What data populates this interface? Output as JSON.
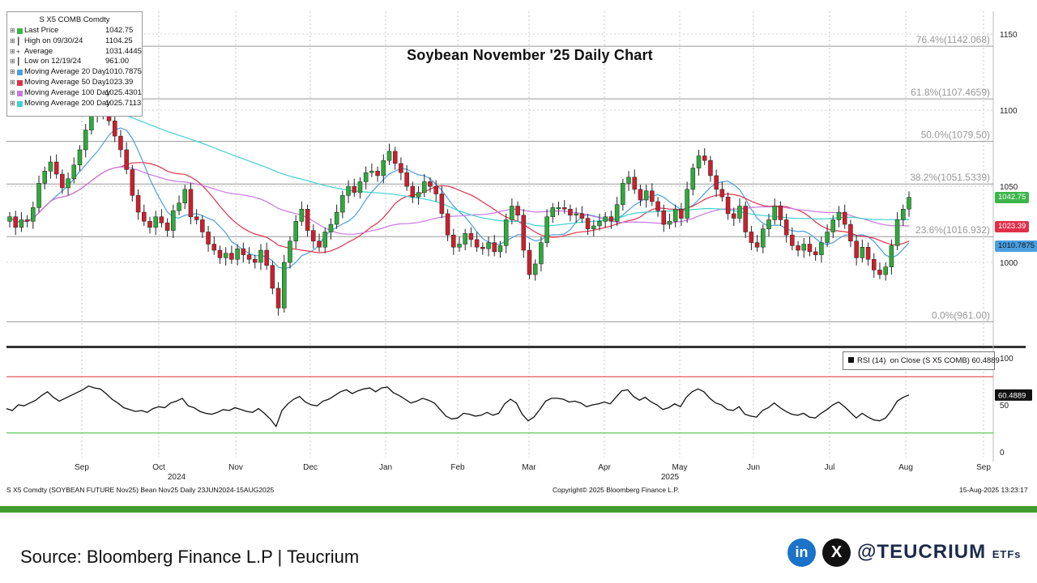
{
  "chart_data": {
    "type": "candlestick",
    "title": "Soybean November '25 Daily Chart",
    "ticker": "S X5 COMB Comdty",
    "x_axis": {
      "months": [
        "Sep",
        "Oct",
        "Nov",
        "Dec",
        "Jan",
        "Feb",
        "Mar",
        "Apr",
        "May",
        "Jun",
        "Jul",
        "Aug",
        "Sep"
      ],
      "years": [
        "2024",
        "2025"
      ]
    },
    "y_axis": {
      "ticks": [
        1150,
        1100,
        1050,
        1000
      ],
      "range": [
        950,
        1165
      ]
    },
    "legend": [
      {
        "label": "Last Price",
        "value": "1042.75",
        "color": "#3bb54a"
      },
      {
        "label": "High on 09/30/24",
        "value": "1104.25",
        "glyph": "T"
      },
      {
        "label": "Average",
        "value": "1031.4445",
        "glyph": "-+-"
      },
      {
        "label": "Low on 12/19/24",
        "value": "961.00",
        "glyph": "L"
      },
      {
        "label": "Moving Average 20 Day",
        "value": "1010.7875",
        "color": "#4a9fe0"
      },
      {
        "label": "Moving Average 50 Day",
        "value": "1023.39",
        "color": "#e0304a"
      },
      {
        "label": "Moving Average 100 Day",
        "value": "1025.4301",
        "color": "#c878e0"
      },
      {
        "label": "Moving Average 200 Day",
        "value": "1025.7113",
        "color": "#40d0d0"
      }
    ],
    "fibonacci": [
      {
        "label": "76.4%(1142.068)",
        "value": 1142.068
      },
      {
        "label": "61.8%(1107.4659)",
        "value": 1107.4659
      },
      {
        "label": "50.0%(1079.50)",
        "value": 1079.5
      },
      {
        "label": "38.2%(1051.5339)",
        "value": 1051.5339
      },
      {
        "label": "23.6%(1016.932)",
        "value": 1016.932
      },
      {
        "label": "0.0%(961.00)",
        "value": 961.0
      }
    ],
    "price_tags": [
      {
        "label": "1042.75",
        "value": 1042.75,
        "color": "#3bb54a"
      },
      {
        "label": "1023.39",
        "value": 1023.39,
        "color": "#e0304a"
      },
      {
        "label": "1010.7875",
        "value": 1010.7875,
        "color": "#4a9fe0"
      }
    ],
    "close_path": [
      1030,
      1023,
      1028,
      1027,
      1036,
      1052,
      1060,
      1066,
      1058,
      1049,
      1055,
      1064,
      1074,
      1087,
      1096,
      1099,
      1101,
      1093,
      1083,
      1074,
      1061,
      1044,
      1033,
      1027,
      1023,
      1030,
      1026,
      1021,
      1034,
      1039,
      1048,
      1030,
      1028,
      1020,
      1012,
      1008,
      1003,
      1006,
      1002,
      1009,
      1005,
      1002,
      1000,
      1008,
      998,
      983,
      970,
      1000,
      1014,
      1027,
      1035,
      1021,
      1014,
      1010,
      1020,
      1025,
      1033,
      1044,
      1050,
      1046,
      1053,
      1059,
      1060,
      1057,
      1067,
      1073,
      1065,
      1059,
      1050,
      1043,
      1046,
      1053,
      1050,
      1045,
      1032,
      1018,
      1010,
      1012,
      1019,
      1015,
      1010,
      1009,
      1013,
      1007,
      1011,
      1028,
      1037,
      1031,
      1008,
      992,
      999,
      1013,
      1030,
      1036,
      1036,
      1035,
      1031,
      1032,
      1029,
      1022,
      1024,
      1027,
      1030,
      1027,
      1038,
      1052,
      1056,
      1048,
      1041,
      1047,
      1040,
      1034,
      1025,
      1027,
      1035,
      1029,
      1048,
      1062,
      1070,
      1067,
      1057,
      1048,
      1043,
      1032,
      1029,
      1037,
      1020,
      1013,
      1010,
      1022,
      1028,
      1037,
      1028,
      1018,
      1011,
      1008,
      1012,
      1007,
      1005,
      1013,
      1020,
      1028,
      1033,
      1025,
      1014,
      1003,
      1010,
      1002,
      995,
      992,
      997,
      1011,
      1028,
      1035,
      1042.75
    ],
    "rsi": {
      "label": "RSI (14)",
      "source": "on Close (S X5 COMB)",
      "value": "60.4889",
      "ticks": [
        100,
        50,
        0
      ],
      "overbought": 80,
      "oversold": 20,
      "series": [
        46,
        44,
        50,
        49,
        52,
        55,
        60,
        64,
        58,
        54,
        57,
        60,
        63,
        66,
        70,
        68,
        67,
        62,
        56,
        52,
        47,
        45,
        43,
        44,
        42,
        46,
        48,
        47,
        52,
        54,
        57,
        49,
        47,
        43,
        41,
        40,
        42,
        45,
        44,
        47,
        45,
        43,
        42,
        46,
        41,
        35,
        27,
        44,
        51,
        56,
        59,
        53,
        50,
        49,
        54,
        56,
        60,
        64,
        66,
        62,
        65,
        67,
        68,
        64,
        68,
        69,
        63,
        60,
        56,
        52,
        54,
        57,
        55,
        52,
        45,
        38,
        35,
        36,
        41,
        40,
        38,
        39,
        42,
        39,
        41,
        51,
        56,
        52,
        40,
        33,
        37,
        45,
        54,
        57,
        57,
        56,
        53,
        54,
        52,
        48,
        50,
        51,
        53,
        51,
        58,
        65,
        66,
        59,
        55,
        58,
        53,
        50,
        45,
        47,
        51,
        48,
        58,
        64,
        67,
        64,
        57,
        52,
        50,
        45,
        44,
        48,
        40,
        38,
        37,
        44,
        47,
        52,
        47,
        43,
        40,
        39,
        41,
        37,
        36,
        41,
        45,
        50,
        53,
        48,
        42,
        36,
        41,
        37,
        34,
        33,
        36,
        44,
        54,
        58,
        60.4889
      ]
    }
  },
  "legend_box": {
    "title": "S X5 COMB Comdty"
  },
  "footer": {
    "left": "S X5 Comdty (SOYBEAN FUTURE   Nov25) Bean Nov25  Daily 23JUN2024-15AUG2025",
    "middle": "Copyright© 2025 Bloomberg Finance L.P.",
    "right": "15-Aug-2025 13:23:17"
  },
  "bottom_bar": {
    "source": "Source: Bloomberg Finance L.P | Teucrium",
    "linkedin_icon": "in",
    "x_icon": "X",
    "brand": "@TEUCRIUM",
    "brand_suffix": "ETFs"
  },
  "colors": {
    "up_candle": "#2eaa3a",
    "down_candle": "#cc1f2d",
    "rsi_overbought": "#e03030",
    "rsi_oversold": "#30c030",
    "band": "#3f9b2c"
  }
}
